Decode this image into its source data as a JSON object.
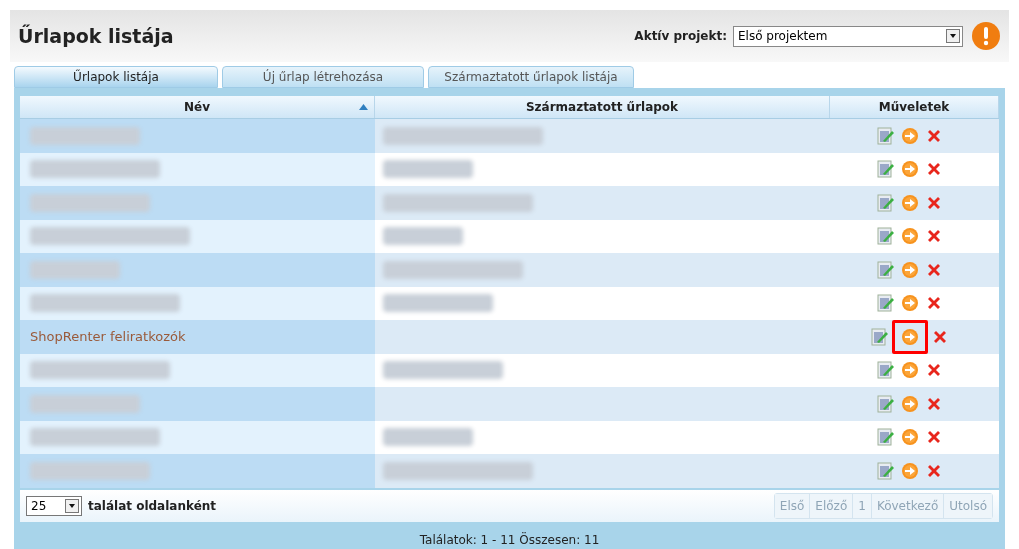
{
  "header": {
    "title": "Űrlapok listája",
    "project_label": "Aktív projekt:",
    "project_value": "Első projektem"
  },
  "tabs": [
    {
      "label": "Űrlapok listája",
      "selected": true
    },
    {
      "label": "Új űrlap létrehozása",
      "selected": false
    },
    {
      "label": "Származtatott űrlapok listája",
      "selected": false
    }
  ],
  "table": {
    "columns": [
      {
        "label": "Név",
        "sorted": true
      },
      {
        "label": "Származtatott űrlapok",
        "sorted": false
      },
      {
        "label": "Műveletek",
        "sorted": false
      }
    ],
    "rows": [
      {
        "name": {
          "kind": "redacted"
        },
        "derived": {
          "kind": "redacted"
        },
        "highlighted": false
      },
      {
        "name": {
          "kind": "redacted"
        },
        "derived": {
          "kind": "redacted"
        },
        "highlighted": false
      },
      {
        "name": {
          "kind": "redacted"
        },
        "derived": {
          "kind": "redacted"
        },
        "highlighted": false
      },
      {
        "name": {
          "kind": "redacted"
        },
        "derived": {
          "kind": "redacted"
        },
        "highlighted": false
      },
      {
        "name": {
          "kind": "redacted"
        },
        "derived": {
          "kind": "redacted"
        },
        "highlighted": false
      },
      {
        "name": {
          "kind": "redacted"
        },
        "derived": {
          "kind": "redacted"
        },
        "highlighted": false
      },
      {
        "name": {
          "kind": "text",
          "text": "ShopRenter feliratkozók"
        },
        "highlighted": true
      },
      {
        "name": {
          "kind": "redacted"
        },
        "derived": {
          "kind": "redacted"
        },
        "highlighted": false
      },
      {
        "name": {
          "kind": "redacted"
        },
        "highlighted": false
      },
      {
        "name": {
          "kind": "redacted"
        },
        "derived": {
          "kind": "redacted"
        },
        "highlighted": false
      },
      {
        "name": {
          "kind": "redacted"
        },
        "derived": {
          "kind": "redacted"
        },
        "highlighted": false
      }
    ]
  },
  "footer": {
    "page_size": "25",
    "page_size_label": "találat oldalanként",
    "pager": [
      {
        "label": "Első",
        "disabled": true
      },
      {
        "label": "Előző",
        "disabled": true
      },
      {
        "label": "1",
        "disabled": true
      },
      {
        "label": "Következő",
        "disabled": true
      },
      {
        "label": "Utolsó",
        "disabled": true
      }
    ],
    "summary": "Találatok: 1 - 11 Összesen: 11"
  }
}
